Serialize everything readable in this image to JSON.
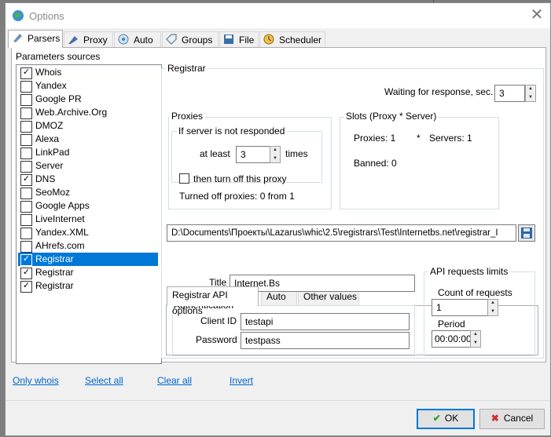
{
  "window": {
    "title": "Options",
    "close_icon": "close-icon"
  },
  "tabs": [
    {
      "label": "Parsers",
      "icon": "parsers-icon"
    },
    {
      "label": "Proxy",
      "icon": "proxy-icon"
    },
    {
      "label": "Auto",
      "icon": "auto-icon"
    },
    {
      "label": "Groups",
      "icon": "groups-icon"
    },
    {
      "label": "File",
      "icon": "file-icon"
    },
    {
      "label": "Scheduler",
      "icon": "scheduler-icon"
    }
  ],
  "sources": {
    "title": "Parameters sources",
    "items": [
      {
        "label": "Whois",
        "checked": true,
        "selected": false
      },
      {
        "label": "Yandex",
        "checked": false,
        "selected": false
      },
      {
        "label": "Google PR",
        "checked": false,
        "selected": false
      },
      {
        "label": "Web.Archive.Org",
        "checked": false,
        "selected": false
      },
      {
        "label": "DMOZ",
        "checked": false,
        "selected": false
      },
      {
        "label": "Alexa",
        "checked": false,
        "selected": false
      },
      {
        "label": "LinkPad",
        "checked": false,
        "selected": false
      },
      {
        "label": "Server",
        "checked": false,
        "selected": false
      },
      {
        "label": "DNS",
        "checked": true,
        "selected": false
      },
      {
        "label": "SeoMoz",
        "checked": false,
        "selected": false
      },
      {
        "label": "Google Apps",
        "checked": false,
        "selected": false
      },
      {
        "label": "LiveInternet",
        "checked": false,
        "selected": false
      },
      {
        "label": "Yandex.XML",
        "checked": false,
        "selected": false
      },
      {
        "label": "AHrefs.com",
        "checked": false,
        "selected": false
      },
      {
        "label": "Registrar",
        "checked": true,
        "selected": true
      },
      {
        "label": "Registrar",
        "checked": true,
        "selected": false
      },
      {
        "label": "Registrar",
        "checked": true,
        "selected": false
      }
    ]
  },
  "links": {
    "only_whois": "Only whois",
    "select_all": "Select all",
    "clear_all": "Clear all",
    "invert": "Invert"
  },
  "registrar": {
    "title": "Registrar",
    "waiting_label": "Waiting for response, sec.",
    "waiting_value": "3",
    "proxies": {
      "title": "Proxies",
      "not_responded_title": "If server is not responded",
      "at_least_label": "at least",
      "at_least_value": "3",
      "times_label": "times",
      "turn_off_label": "then turn off this proxy",
      "turn_off_checked": false,
      "turned_off_text": "Turned off proxies: 0 from 1"
    },
    "slots": {
      "title": "Slots (Proxy * Server)",
      "proxies_text": "Proxies: 1",
      "star": "*",
      "servers_text": "Servers: 1",
      "banned_text": "Banned: 0"
    },
    "path_value": "D:\\Documents\\Проекты\\Lazarus\\whic\\2.5\\registrars\\Test\\Internetbs.net\\registrar_I",
    "folder_icon": "save-icon",
    "inner_tabs": [
      "Registrar API options",
      "Auto",
      "Other values"
    ],
    "api": {
      "title_label": "Title",
      "title_value": "Internet.Bs",
      "auth_title": "Authentication",
      "client_id_label": "Client ID",
      "client_id_value": "testapi",
      "password_label": "Password",
      "password_value": "testpass",
      "limits_title": "API requests limits",
      "count_label": "Count of requests",
      "count_value": "1",
      "period_label": "Period",
      "period_value": "00:00:00"
    }
  },
  "buttons": {
    "ok": "OK",
    "cancel": "Cancel"
  },
  "colors": {
    "selection": "#0078d7",
    "link": "#0066cc",
    "ok_check": "#2e9e2e",
    "cancel_x": "#d32f2f"
  }
}
